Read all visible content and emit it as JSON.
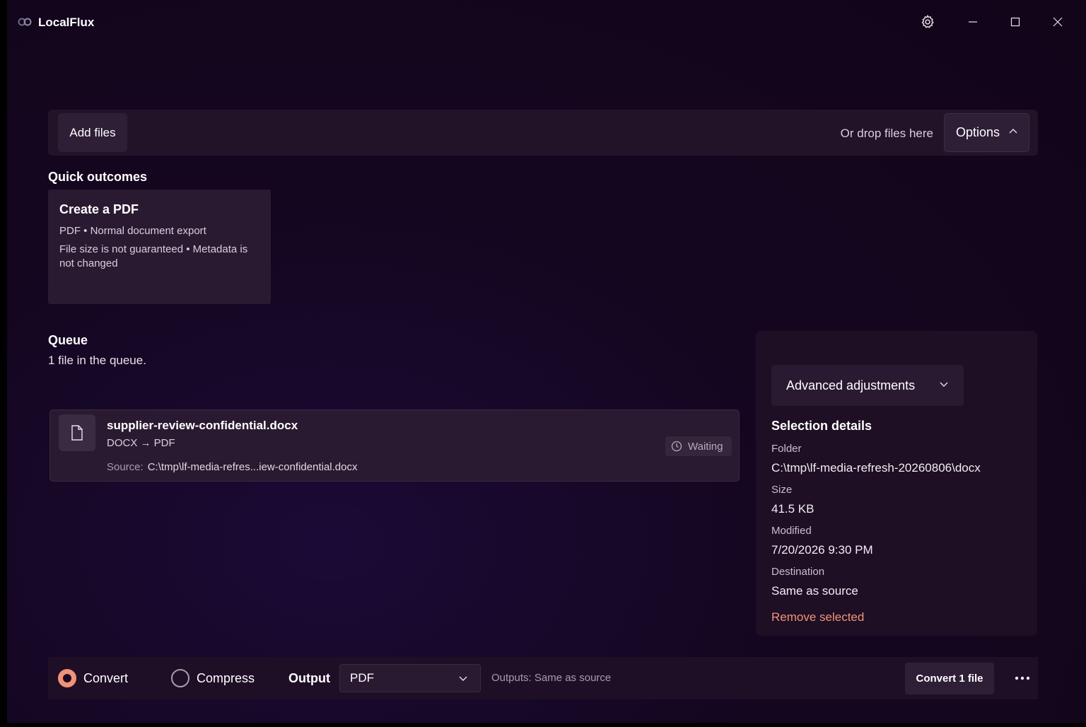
{
  "app": {
    "title": "LocalFlux"
  },
  "dropbar": {
    "add_files_label": "Add files",
    "drop_hint": "Or drop files here",
    "options_label": "Options"
  },
  "quick_outcomes": {
    "title": "Quick outcomes",
    "cards": [
      {
        "title": "Create a PDF",
        "line1": "PDF • Normal document export",
        "line2": "File size is not guaranteed • Metadata is not changed"
      }
    ]
  },
  "queue": {
    "title": "Queue",
    "count_text": "1 file in the queue.",
    "items": [
      {
        "name": "supplier-review-confidential.docx",
        "conversion": "DOCX → PDF",
        "source_label": "Source:",
        "source_path": "C:\\tmp\\lf-media-refres...iew-confidential.docx",
        "status": "Waiting"
      }
    ]
  },
  "side_panel": {
    "advanced_label": "Advanced adjustments",
    "details_title": "Selection details",
    "folder_label": "Folder",
    "folder_value": "C:\\tmp\\lf-media-refresh-20260806\\docx",
    "size_label": "Size",
    "size_value": "41.5 KB",
    "modified_label": "Modified",
    "modified_value": "7/20/2026 9:30 PM",
    "destination_label": "Destination",
    "destination_value": "Same as source",
    "remove_label": "Remove selected"
  },
  "bottombar": {
    "mode_convert": "Convert",
    "mode_compress": "Compress",
    "selected_mode": "Convert",
    "output_label": "Output",
    "output_value": "PDF",
    "outputs_hint": "Outputs: Same as source",
    "convert_button": "Convert 1 file"
  },
  "colors": {
    "accent": "#f0927a",
    "background": "#14061f",
    "panel": "#2a1a31"
  }
}
